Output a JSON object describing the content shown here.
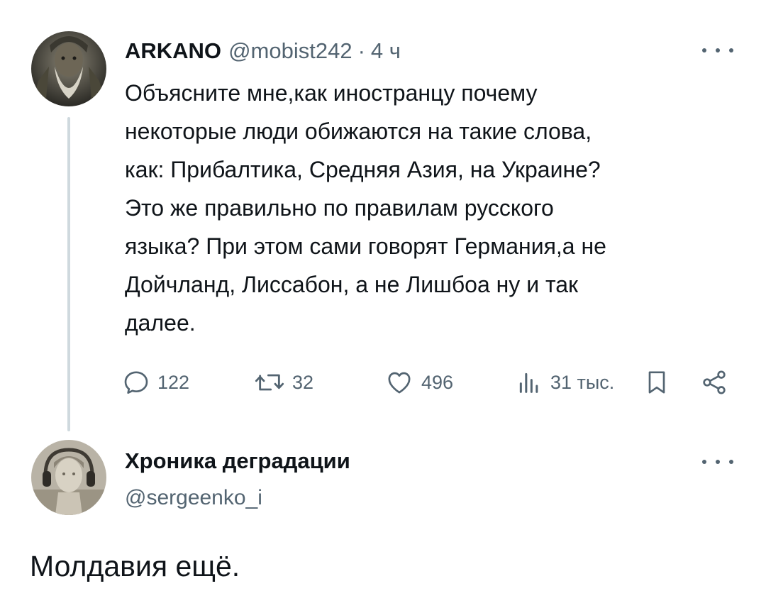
{
  "tweet": {
    "author_name": "ARKANO",
    "author_handle": "@mobist242",
    "separator": "·",
    "time": "4 ч",
    "text": "Объясните мне,как иностранцу  почему\nнекоторые люди обижаются на такие слова,\nкак: Прибалтика, Средняя Азия, на Украине?\nЭто же правильно по правилам русского\nязыка? При этом сами говорят Германия,а не\nДойчланд, Лиссабон, а не Лишбоа ну и так\nдалее.",
    "stats": {
      "replies": "122",
      "retweets": "32",
      "likes": "496",
      "views": "31 тыс."
    },
    "icons": [
      "reply-icon",
      "retweet-icon",
      "like-icon",
      "views-icon",
      "bookmark-icon",
      "share-icon",
      "more-icon"
    ]
  },
  "reply": {
    "author_name": "Хроника деградации",
    "author_handle": "@sergeenko_i",
    "text": "Молдавия ещё."
  },
  "colors": {
    "text": "#0f1419",
    "secondary": "#536471",
    "thread_line": "#cfd9de",
    "background": "#ffffff"
  }
}
